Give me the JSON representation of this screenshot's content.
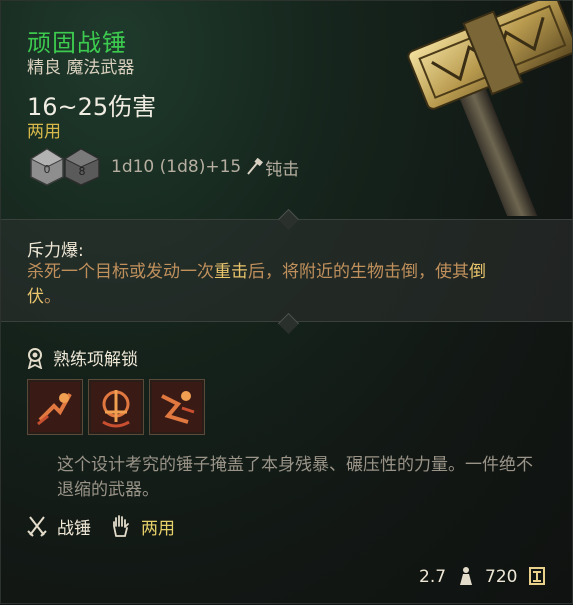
{
  "item": {
    "name": "顽固战锤",
    "subtitle": "精良 魔法武器",
    "damage": "16~25伤害",
    "handedness": "两用",
    "dice_formula": "1d10 (1d8)+15",
    "damage_type": "钝击",
    "name_color": "#3ccb4e"
  },
  "action": {
    "title": "斥力爆:",
    "desc_part1": "杀死一个目标或发动一次",
    "desc_highlight1": "重击",
    "desc_part2": "后，将附近的生物击倒，使其",
    "desc_highlight2": "倒伏",
    "desc_part3": "。"
  },
  "proficiency": {
    "label": "熟练项解锁",
    "skills": [
      {
        "name": "skill-1-icon"
      },
      {
        "name": "skill-2-icon"
      },
      {
        "name": "skill-3-icon"
      }
    ]
  },
  "flavor": "这个设计考究的锤子掩盖了本身残暴、碾压性的力量。一件绝不退缩的武器。",
  "tags": {
    "weapon_type": "战锤",
    "hands": "两用"
  },
  "footer": {
    "weight": "2.7",
    "price": "720"
  }
}
